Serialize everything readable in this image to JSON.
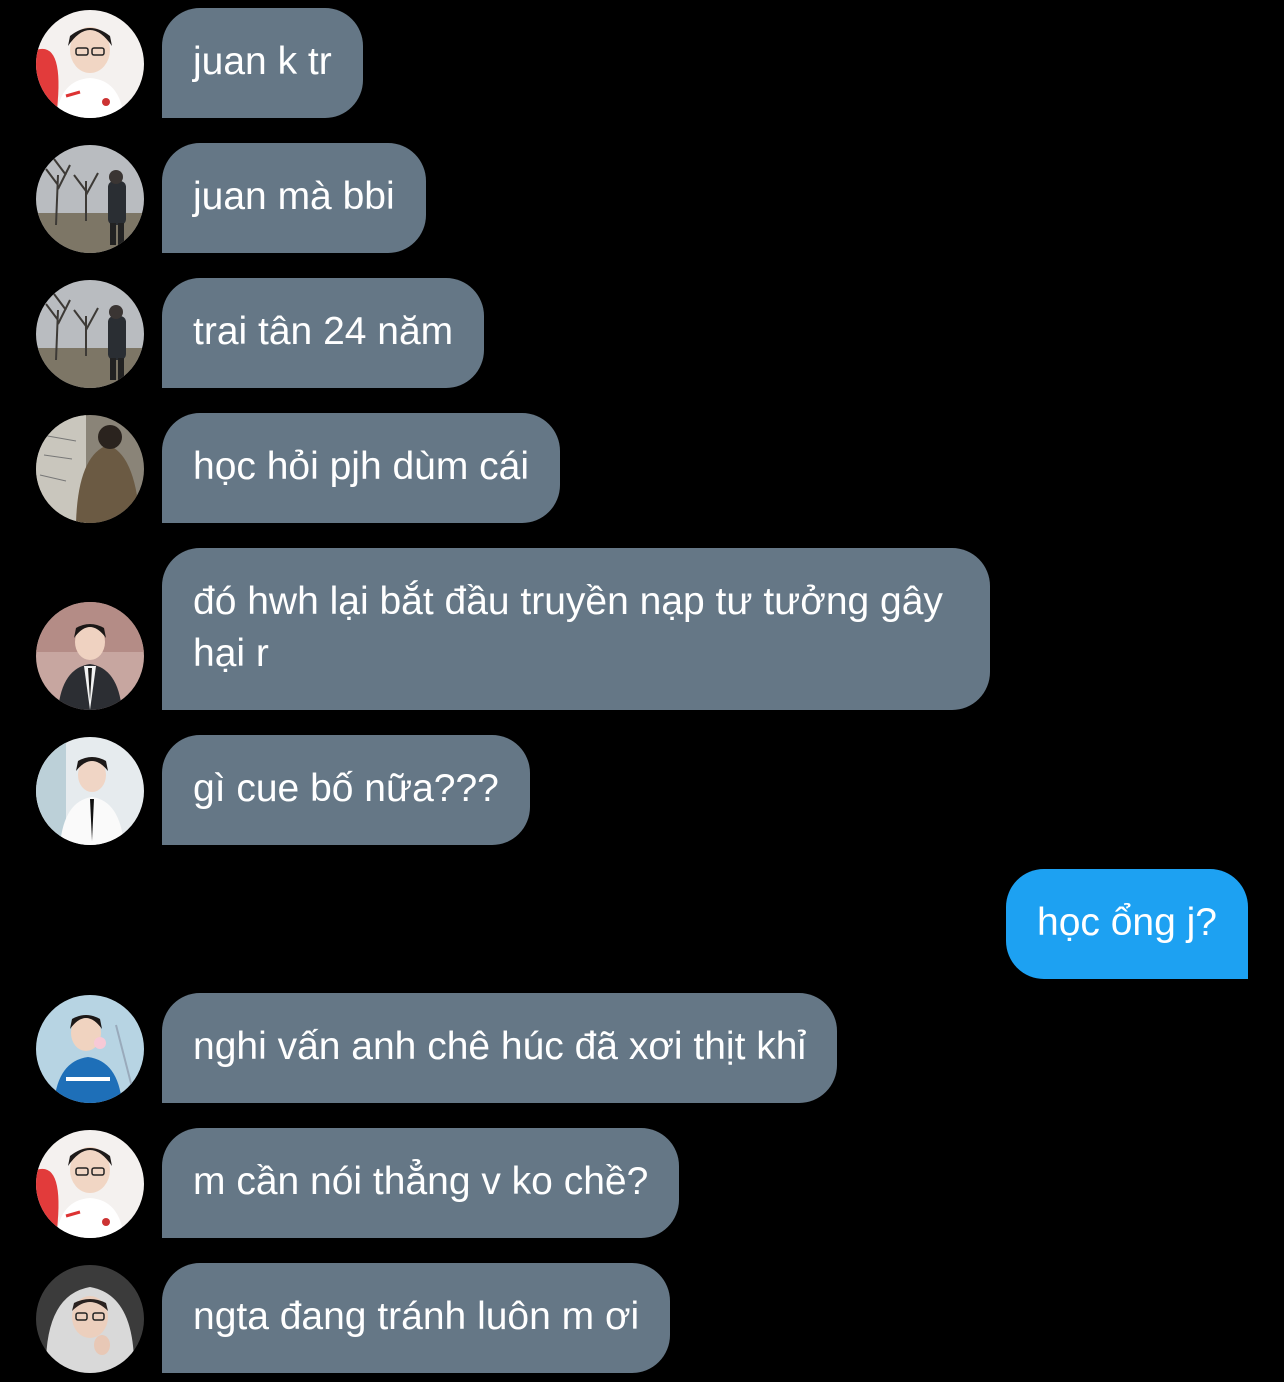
{
  "colors": {
    "background": "#000000",
    "incoming_bubble": "#657786",
    "outgoing_bubble": "#1da1f2",
    "text": "#ffffff"
  },
  "messages": [
    {
      "sender": "other",
      "avatar": "avatar-red-jersey",
      "text": "juan k tr"
    },
    {
      "sender": "other",
      "avatar": "avatar-trees",
      "text": "juan mà bbi"
    },
    {
      "sender": "other",
      "avatar": "avatar-trees",
      "text": "trai tân 24 năm"
    },
    {
      "sender": "other",
      "avatar": "avatar-jacket",
      "text": "học hỏi pjh dùm cái"
    },
    {
      "sender": "other",
      "avatar": "avatar-suit-dark",
      "text": "đó hwh lại bắt đầu truyền nạp tư tưởng gây hại r"
    },
    {
      "sender": "other",
      "avatar": "avatar-suit-light",
      "text": "gì cue bố nữa???"
    },
    {
      "sender": "me",
      "text": "học ổng j?"
    },
    {
      "sender": "other",
      "avatar": "avatar-blue-jersey",
      "text": "nghi vấn anh chê húc đã xơi thịt khỉ"
    },
    {
      "sender": "other",
      "avatar": "avatar-red-jersey",
      "text": "m cần nói thẳng v ko chề?"
    },
    {
      "sender": "other",
      "avatar": "avatar-hood",
      "text": "ngta đang tránh luôn m ơi"
    }
  ]
}
